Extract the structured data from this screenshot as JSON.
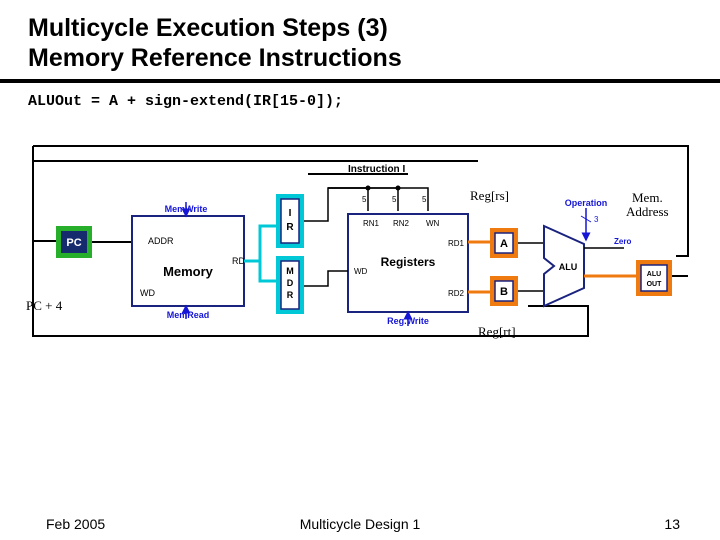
{
  "title_line1": "Multicycle Execution Steps (3)",
  "title_line2": "Memory Reference Instructions",
  "code": "ALUOut = A + sign-extend(IR[15-0]);",
  "labels": {
    "pc": "PC",
    "memwrite": "MemWrite",
    "memread": "MemRead",
    "addr": "ADDR",
    "rd": "RD",
    "wd": "WD",
    "memory": "Memory",
    "ir": "I\nR",
    "mdr": "M\nD\nR",
    "instruction_i": "Instruction I",
    "rn1": "RN1",
    "rn2": "RN2",
    "wn": "WN",
    "rd1": "RD1",
    "rd2": "RD2",
    "registers": "Registers",
    "regwrite": "Reg.Write",
    "a": "A",
    "b": "B",
    "alu": "ALU",
    "operation": "Operation",
    "op3": "3",
    "zero": "Zero",
    "aluout": "ALU\nOUT",
    "reg_rs": "Reg[rs]",
    "reg_rt": "Reg[rt]",
    "mem_addr_l1": "Mem.",
    "mem_addr_l2": "Address",
    "pc4": "PC + 4",
    "b5a": "5",
    "b5b": "5",
    "b5c": "5"
  },
  "footer": {
    "left": "Feb 2005",
    "center": "Multicycle Design 1",
    "right": "13"
  }
}
